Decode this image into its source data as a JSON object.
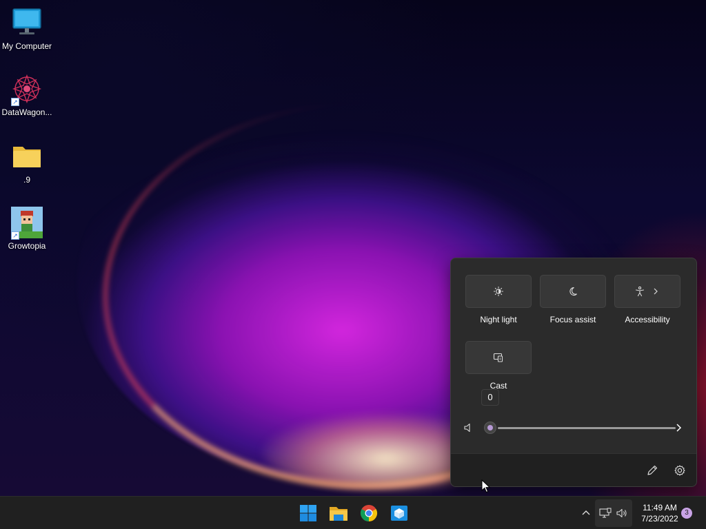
{
  "desktop": {
    "icons": [
      {
        "label": "My Computer",
        "icon": "monitor-icon"
      },
      {
        "label": "DataWagon...",
        "icon": "datawagon-logo-icon",
        "shortcut": true
      },
      {
        "label": ".9",
        "icon": "folder-icon"
      },
      {
        "label": "Growtopia",
        "icon": "growtopia-icon",
        "shortcut": true
      }
    ]
  },
  "quick_settings": {
    "tiles": [
      {
        "label": "Night light",
        "icon": "night-light-icon"
      },
      {
        "label": "Focus assist",
        "icon": "moon-icon"
      },
      {
        "label": "Accessibility",
        "icon": "accessibility-icon",
        "has_submenu": true
      },
      {
        "label": "Cast",
        "icon": "cast-icon"
      }
    ],
    "volume": {
      "tooltip": "0",
      "level_percent": 0,
      "icon": "speaker-muted-icon"
    },
    "footer": {
      "edit_icon": "pencil-icon",
      "settings_icon": "gear-icon"
    }
  },
  "taskbar": {
    "apps": [
      {
        "name": "Start",
        "icon": "windows-start-icon"
      },
      {
        "name": "File Explorer",
        "icon": "file-explorer-icon"
      },
      {
        "name": "Google Chrome",
        "icon": "chrome-icon"
      },
      {
        "name": "Store",
        "icon": "store-box-icon"
      }
    ],
    "tray": {
      "network_icon": "network-icon",
      "volume_icon": "volume-icon"
    },
    "clock": {
      "time": "11:49 AM",
      "date": "7/23/2022"
    },
    "notifications_count": "3"
  },
  "colors": {
    "panel_bg": "#2b2b2b",
    "taskbar_bg": "#202020",
    "accent": "#b79ad6"
  }
}
